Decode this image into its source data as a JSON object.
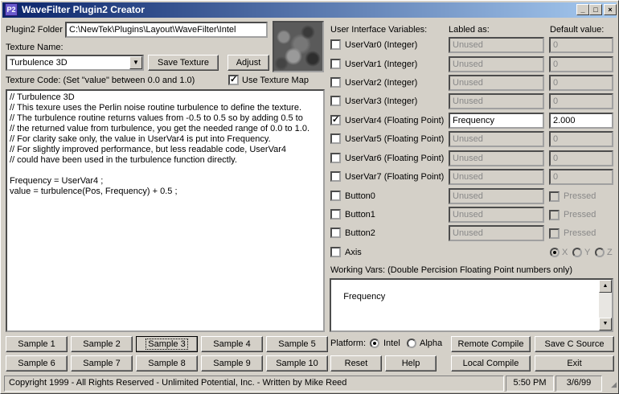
{
  "window": {
    "title": "WaveFilter Plugin2 Creator",
    "icon": "P2",
    "minimize_glyph": "_",
    "maximize_glyph": "□",
    "close_glyph": "×"
  },
  "left": {
    "folder_label": "Plugin2 Folder :",
    "folder_value": "C:\\NewTek\\Plugins\\Layout\\WaveFilter\\Intel",
    "texture_name_label": "Texture Name:",
    "texture_name_value": "Turbulence 3D",
    "save_texture": "Save Texture",
    "adjust": "Adjust",
    "code_label": "Texture Code: (Set \"value\" between 0.0 and 1.0)",
    "use_texture_map": "Use Texture Map",
    "code": "// Turbulence 3D\n// This texure uses the Perlin noise routine turbulence to define the texture.\n// The turbulence routine returns values from -0.5 to 0.5 so by adding 0.5 to\n// the returned value from turbulence, you get the needed range of 0.0 to 1.0.\n// For clarity sake only, the value in UserVar4 is put into Frequency.\n// For slightly improved performance, but less readable code, UserVar4\n// could have been used in the turbulence function directly.\n\nFrequency = UserVar4 ;\nvalue = turbulence(Pos, Frequency) + 0.5 ;"
  },
  "right": {
    "ui_vars_label": "User Interface Variables:",
    "labeled_as_label": "Labled as:",
    "default_label": "Default value:",
    "rows": [
      {
        "name": "UserVar0 (Integer)",
        "label": "Unused",
        "default": "0",
        "checked": false
      },
      {
        "name": "UserVar1 (Integer)",
        "label": "Unused",
        "default": "0",
        "checked": false
      },
      {
        "name": "UserVar2 (Integer)",
        "label": "Unused",
        "default": "0",
        "checked": false
      },
      {
        "name": "UserVar3 (Integer)",
        "label": "Unused",
        "default": "0",
        "checked": false
      },
      {
        "name": "UserVar4 (Floating Point)",
        "label": "Frequency",
        "default": "2.000",
        "checked": true
      },
      {
        "name": "UserVar5 (Floating Point)",
        "label": "Unused",
        "default": "0",
        "checked": false
      },
      {
        "name": "UserVar6 (Floating Point)",
        "label": "Unused",
        "default": "0",
        "checked": false
      },
      {
        "name": "UserVar7 (Floating Point)",
        "label": "Unused",
        "default": "0",
        "checked": false
      }
    ],
    "buttons": [
      {
        "name": "Button0",
        "label": "Unused",
        "pressed": "Pressed"
      },
      {
        "name": "Button1",
        "label": "Unused",
        "pressed": "Pressed"
      },
      {
        "name": "Button2",
        "label": "Unused",
        "pressed": "Pressed"
      }
    ],
    "axis": "Axis",
    "axis_x": "X",
    "axis_y": "Y",
    "axis_z": "Z",
    "working_vars_label": "Working Vars: (Double Percision Floating Point numbers only)",
    "working_vars_value": "Frequency"
  },
  "bottom": {
    "samples_row1": [
      "Sample 1",
      "Sample 2",
      "Sample 3",
      "Sample 4",
      "Sample 5"
    ],
    "samples_row2": [
      "Sample 6",
      "Sample 7",
      "Sample 8",
      "Sample 9",
      "Sample 10"
    ],
    "reset": "Reset",
    "help": "Help",
    "platform_label": "Platform:",
    "platform_intel": "Intel",
    "platform_alpha": "Alpha",
    "remote_compile": "Remote Compile",
    "save_c_source": "Save C Source",
    "local_compile": "Local Compile",
    "exit": "Exit"
  },
  "status": {
    "copyright": "Copyright 1999 - All Rights Reserved - Unlimited Potential, Inc. - Written by Mike Reed",
    "time": "5:50 PM",
    "date": "3/6/99"
  },
  "icons": {
    "combo_arrow": "▼",
    "scroll_up": "▲",
    "scroll_down": "▼",
    "checkmark": "✓"
  }
}
